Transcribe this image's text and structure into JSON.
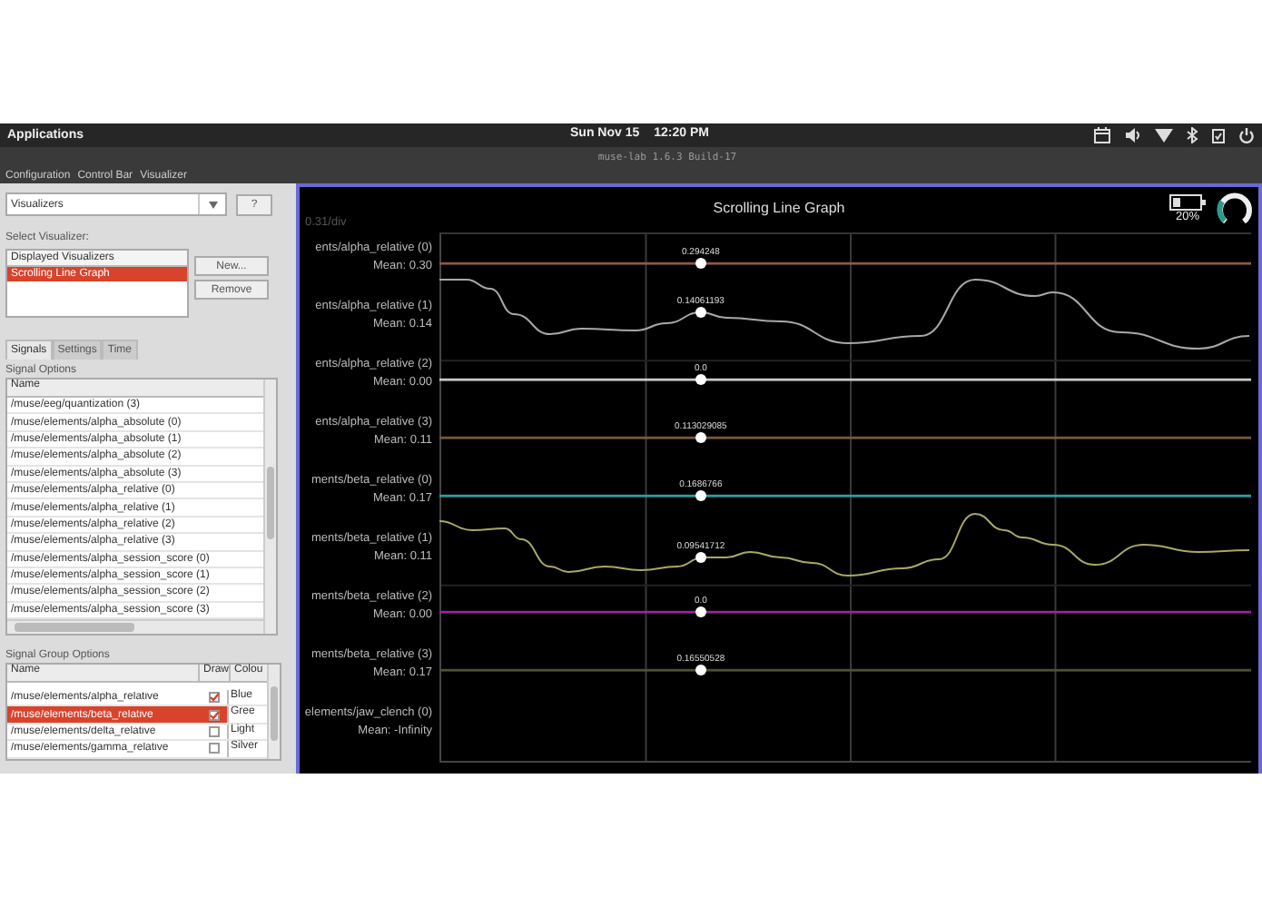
{
  "top_bar": {
    "menu": "Applications",
    "date": "Sun Nov 15",
    "time": "12:20 PM"
  },
  "window": {
    "title": "muse-lab 1.6.3 Build-17"
  },
  "menu": [
    "Configuration",
    "Control Bar",
    "Visualizer"
  ],
  "sidebar": {
    "dropdown": {
      "value": "Visualizers"
    },
    "help_button": "?",
    "select_label": "Select Visualizer:",
    "visualizer_list": {
      "header": "Displayed Visualizers",
      "items": [
        {
          "label": "Scrolling Line Graph",
          "selected": true
        }
      ]
    },
    "buttons": [
      "New...",
      "Remove"
    ],
    "tabs": [
      {
        "label": "Signals",
        "selected": true
      },
      {
        "label": "Settings",
        "selected": false
      },
      {
        "label": "Time",
        "selected": false
      }
    ],
    "signal_options": {
      "title": "Signal Options",
      "column": "Name",
      "rows": [
        "/muse/eeg/quantization (3)",
        "/muse/elements/alpha_absolute (0)",
        "/muse/elements/alpha_absolute (1)",
        "/muse/elements/alpha_absolute (2)",
        "/muse/elements/alpha_absolute (3)",
        "/muse/elements/alpha_relative (0)",
        "/muse/elements/alpha_relative (1)",
        "/muse/elements/alpha_relative (2)",
        "/muse/elements/alpha_relative (3)",
        "/muse/elements/alpha_session_score (0)",
        "/muse/elements/alpha_session_score (1)",
        "/muse/elements/alpha_session_score (2)",
        "/muse/elements/alpha_session_score (3)"
      ]
    },
    "signal_group_options": {
      "title": "Signal Group Options",
      "columns": [
        "Name",
        "Draw",
        "Colou"
      ],
      "rows": [
        {
          "name": "/muse/elements/alpha_relative",
          "draw": true,
          "colour": "Blue",
          "selected": false
        },
        {
          "name": "/muse/elements/beta_relative",
          "draw": true,
          "colour": "Gree",
          "selected": true
        },
        {
          "name": "/muse/elements/delta_relative",
          "draw": false,
          "colour": "Light",
          "selected": false
        },
        {
          "name": "/muse/elements/gamma_relative",
          "draw": false,
          "colour": "Silver",
          "selected": false
        }
      ]
    }
  },
  "graph": {
    "scale": "0.31/div",
    "title": "Scrolling Line Graph",
    "battery": {
      "reading": "20%"
    },
    "traces": [
      {
        "kind": "flat",
        "label": "ents/alpha_relative (0)",
        "mean": "Mean: 0.30",
        "value": "0.294248",
        "color": "#8a5a48"
      },
      {
        "kind": "wave",
        "label": "ents/alpha_relative (1)",
        "mean": "Mean: 0.14",
        "value": "0.14061193",
        "color": "#a8a8a8"
      },
      {
        "kind": "flat",
        "label": "ents/alpha_relative (2)",
        "mean": "Mean: 0.00",
        "value": "0.0",
        "color": "#c8c8c8"
      },
      {
        "kind": "flat",
        "label": "ents/alpha_relative (3)",
        "mean": "Mean: 0.11",
        "value": "0.113029085",
        "color": "#7a5838"
      },
      {
        "kind": "flat",
        "label": "ments/beta_relative (0)",
        "mean": "Mean: 0.17",
        "value": "0.1686766",
        "color": "#2aa0a0"
      },
      {
        "kind": "wave",
        "label": "ments/beta_relative (1)",
        "mean": "Mean: 0.11",
        "value": "0.09541712",
        "color": "#a8a868"
      },
      {
        "kind": "flat",
        "label": "ments/beta_relative (2)",
        "mean": "Mean: 0.00",
        "value": "0.0",
        "color": "#a020a0"
      },
      {
        "kind": "flat",
        "label": "ments/beta_relative (3)",
        "mean": "Mean: 0.17",
        "value": "0.16550528",
        "color": "#505038"
      },
      {
        "kind": "none",
        "label": "elements/jaw_clench (0)",
        "mean": "Mean: -Infinity"
      }
    ]
  }
}
